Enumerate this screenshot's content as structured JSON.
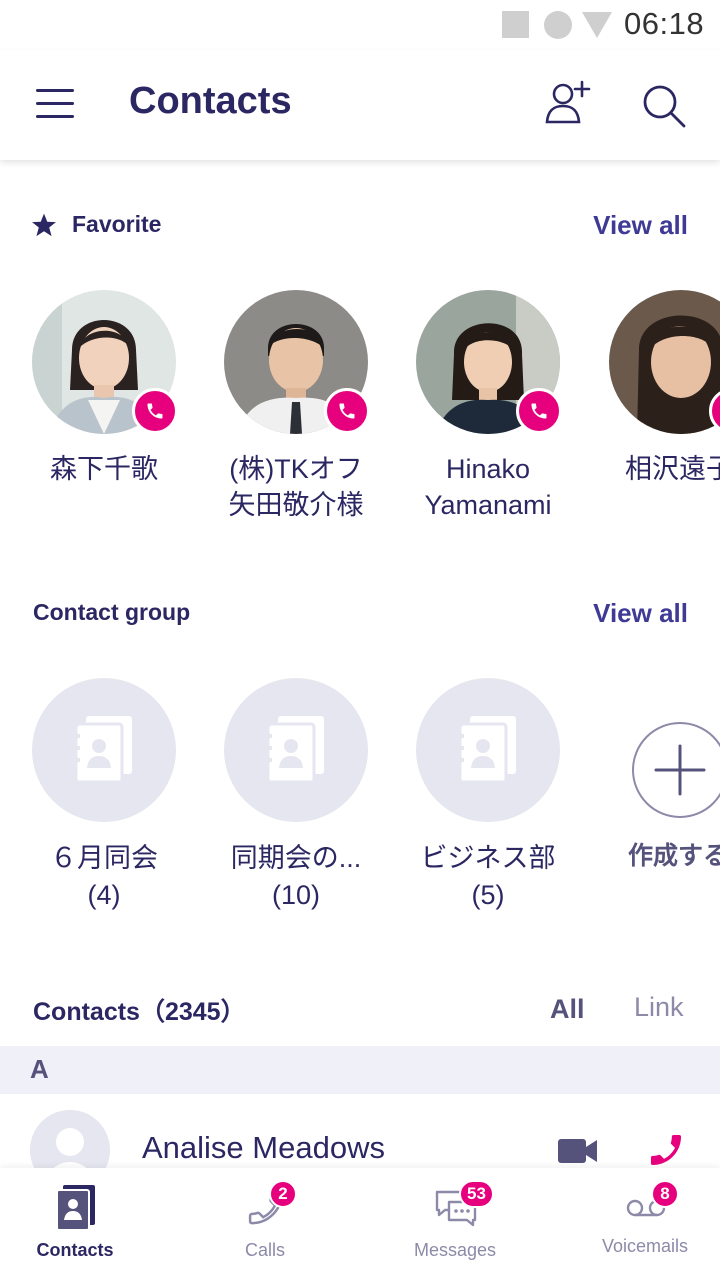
{
  "status_bar": {
    "time": "06:18"
  },
  "app_bar": {
    "title": "Contacts"
  },
  "favorites": {
    "title": "Favorite",
    "view_all": "View all",
    "items": [
      {
        "name": "森下千歌"
      },
      {
        "name": "(株)TKオフ\n矢田敬介様"
      },
      {
        "name": "Hinako\nYamanami"
      },
      {
        "name": "相沢遠子"
      }
    ]
  },
  "groups": {
    "title": "Contact group",
    "view_all": "View all",
    "items": [
      {
        "name": "６月同会",
        "count": "(4)"
      },
      {
        "name": "同期会の...",
        "count": "(10)"
      },
      {
        "name": "ビジネス部",
        "count": "(5)"
      }
    ],
    "create_label": "作成する"
  },
  "contacts": {
    "title": "Contacts（2345）",
    "filter_all": "All",
    "filter_link": "Link",
    "letter": "A",
    "rows": [
      {
        "name": "Analise Meadows"
      }
    ]
  },
  "bottom_nav": {
    "items": [
      {
        "label": "Contacts",
        "badge": ""
      },
      {
        "label": "Calls",
        "badge": "2"
      },
      {
        "label": "Messages",
        "badge": "53"
      },
      {
        "label": "Voicemails",
        "badge": "8"
      }
    ]
  },
  "colors": {
    "primary": "#2b2762",
    "accent": "#e6007e",
    "link": "#3e3a96",
    "group_bg": "#e6e6f0"
  }
}
